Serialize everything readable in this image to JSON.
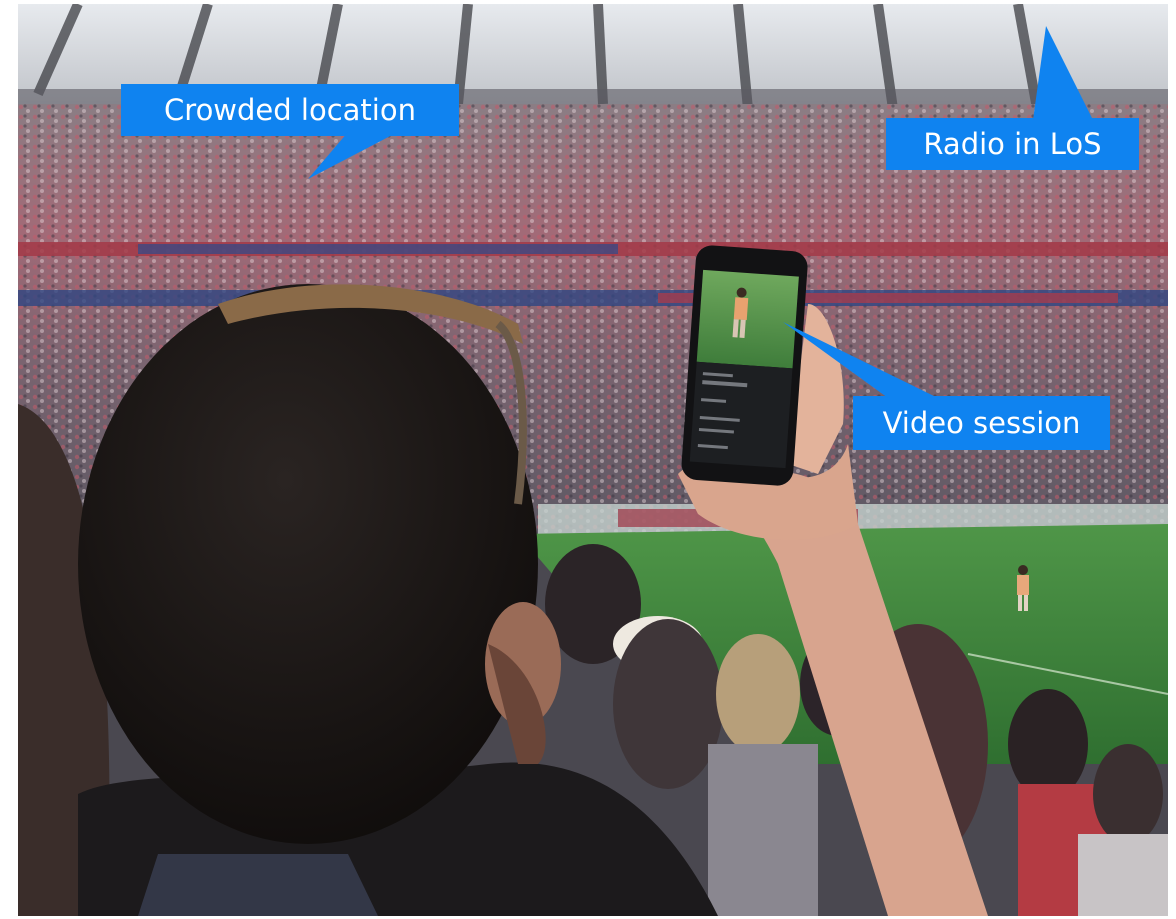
{
  "callouts": {
    "crowded": "Crowded location",
    "radio": "Radio in LoS",
    "video": "Video session"
  },
  "colors": {
    "callout_fill": "#0f83f0",
    "callout_text": "#ffffff",
    "pitch": "#3f8a3c",
    "crowd_red": "#b84a58",
    "roof": "#d9dde1"
  },
  "icons": {
    "callout_shape": "speech-bubble-icon"
  }
}
